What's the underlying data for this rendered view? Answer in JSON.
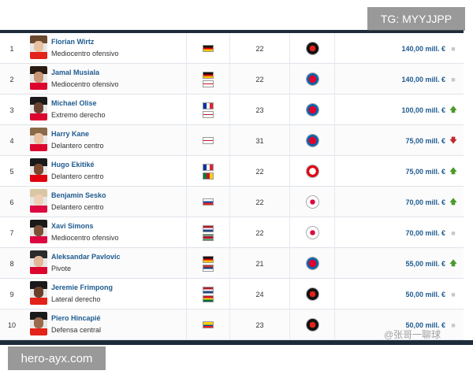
{
  "watermarks": {
    "telegram": "TG: MYYJJPP",
    "site": "hero-ayx.com",
    "weibo": "@张哥一聊球"
  },
  "players": [
    {
      "rank": "1",
      "name": "Florian Wirtz",
      "position": "Mediocentro ofensivo",
      "nationality": [
        "germany"
      ],
      "age": "22",
      "club": "bayer-leverkusen",
      "value": "140,00 mill. €",
      "trend": "flat"
    },
    {
      "rank": "2",
      "name": "Jamal Musiala",
      "position": "Mediocentro ofensivo",
      "nationality": [
        "germany",
        "england"
      ],
      "age": "22",
      "club": "bayern-munich",
      "value": "140,00 mill. €",
      "trend": "flat"
    },
    {
      "rank": "3",
      "name": "Michael Olise",
      "position": "Extremo derecho",
      "nationality": [
        "france",
        "england"
      ],
      "age": "23",
      "club": "bayern-munich",
      "value": "100,00 mill. €",
      "trend": "up"
    },
    {
      "rank": "4",
      "name": "Harry Kane",
      "position": "Delantero centro",
      "nationality": [
        "england"
      ],
      "age": "31",
      "club": "bayern-munich",
      "value": "75,00 mill. €",
      "trend": "down"
    },
    {
      "rank": "5",
      "name": "Hugo Ekitiké",
      "position": "Delantero centro",
      "nationality": [
        "france",
        "cameroon"
      ],
      "age": "22",
      "club": "eintracht-frankfurt",
      "value": "75,00 mill. €",
      "trend": "up"
    },
    {
      "rank": "6",
      "name": "Benjamin Sesko",
      "position": "Delantero centro",
      "nationality": [
        "slovenia"
      ],
      "age": "22",
      "club": "rb-leipzig",
      "value": "70,00 mill. €",
      "trend": "up"
    },
    {
      "rank": "7",
      "name": "Xavi Simons",
      "position": "Mediocentro ofensivo",
      "nationality": [
        "netherlands",
        "suriname"
      ],
      "age": "22",
      "club": "rb-leipzig",
      "value": "70,00 mill. €",
      "trend": "flat"
    },
    {
      "rank": "8",
      "name": "Aleksandar Pavlovic",
      "position": "Pivote",
      "nationality": [
        "germany",
        "serbia"
      ],
      "age": "21",
      "club": "bayern-munich",
      "value": "55,00 mill. €",
      "trend": "up"
    },
    {
      "rank": "9",
      "name": "Jeremie Frimpong",
      "position": "Lateral derecho",
      "nationality": [
        "netherlands",
        "ghana"
      ],
      "age": "24",
      "club": "bayer-leverkusen",
      "value": "50,00 mill. €",
      "trend": "flat"
    },
    {
      "rank": "10",
      "name": "Piero Hincapié",
      "position": "Defensa central",
      "nationality": [
        "ecuador"
      ],
      "age": "23",
      "club": "bayer-leverkusen",
      "value": "50,00 mill. €",
      "trend": "flat"
    }
  ],
  "colors": {
    "name_link": "#1e5b8f",
    "trend_up": "#4a9a2a",
    "trend_down": "#c0272d",
    "trend_flat": "#c8c8c8",
    "header_bar": "#1d2b3a"
  }
}
